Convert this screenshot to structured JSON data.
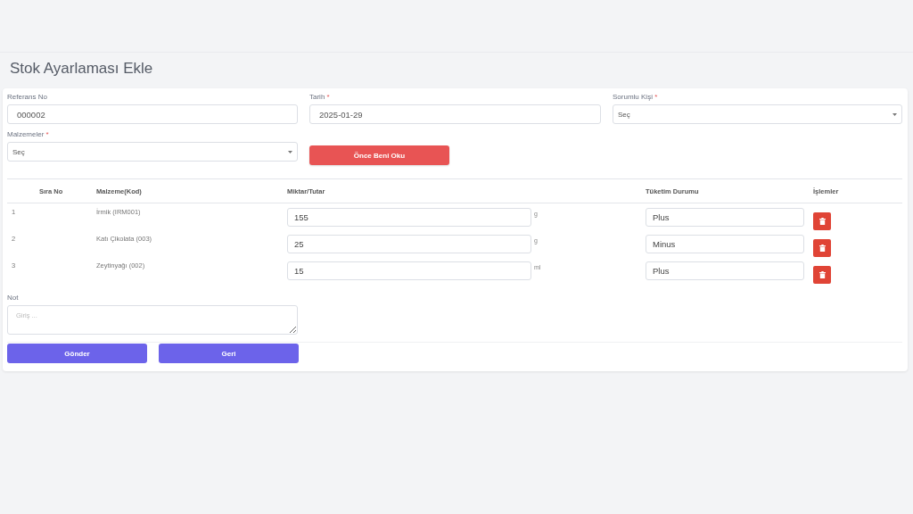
{
  "page_title": "Stok Ayarlaması Ekle",
  "fields": [
    {
      "label": "Referans No",
      "kind": "input",
      "value": "000002"
    },
    {
      "label": "Tarih",
      "required_mark": "*",
      "kind": "input",
      "value": "2025-01-29"
    },
    {
      "label": "Sorumlu Kişi",
      "required_mark": "*",
      "kind": "select",
      "value": "Seç"
    },
    {
      "label": "Malzemeler",
      "required_mark": "*",
      "kind": "select",
      "value": "Seç"
    }
  ],
  "read_first_button": "Önce Beni Oku",
  "table": {
    "columns": [
      "Sıra No",
      "Malzeme(Kod)",
      "Miktar/Tutar",
      "Tüketim Durumu",
      "İşlemler"
    ],
    "rows": [
      {
        "index": "1",
        "material": "İrmik (IRM001)",
        "amount": "155",
        "unit": "g",
        "status": "Plus"
      },
      {
        "index": "2",
        "material": "Katı Çikolata (003)",
        "amount": "25",
        "unit": "g",
        "status": "Minus"
      },
      {
        "index": "3",
        "material": "Zeytinyağı (002)",
        "amount": "15",
        "unit": "ml",
        "status": "Plus"
      }
    ]
  },
  "note": {
    "label": "Not",
    "placeholder": "Giriş ..."
  },
  "buttons": [
    "Gönder",
    "Geri"
  ]
}
